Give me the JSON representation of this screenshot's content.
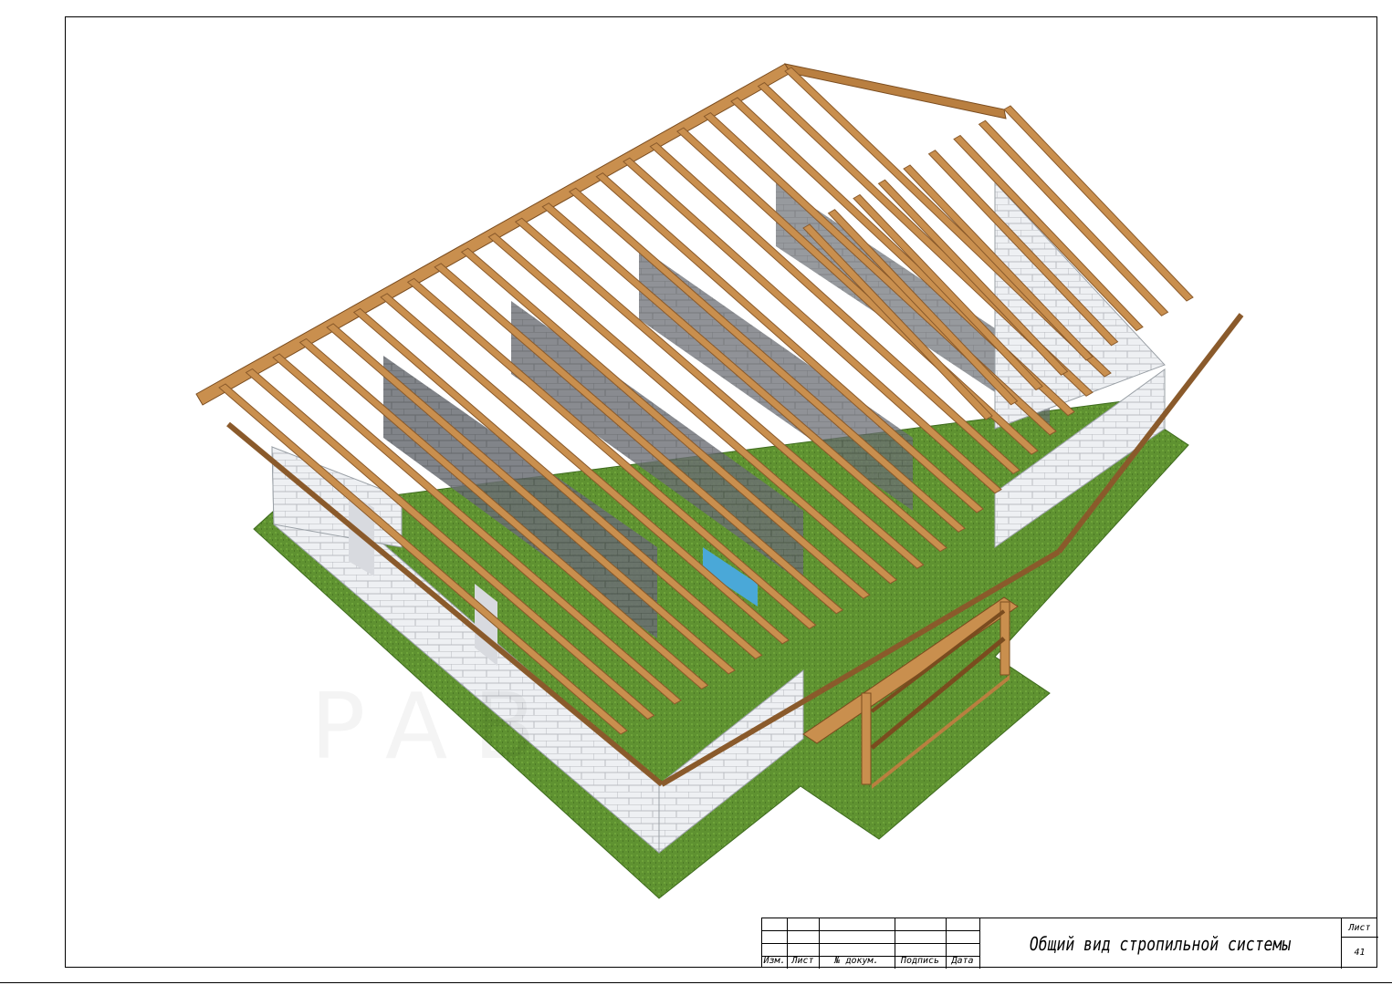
{
  "drawing": {
    "subject": "roof rafter system 3d view",
    "watermark": "PAB"
  },
  "title_block": {
    "col_izm": "Изм.",
    "col_list": "Лист",
    "col_doc": "№ докум.",
    "col_sign": "Подпись",
    "col_date": "Дата",
    "sheet_title": "Общий вид стропильной системы",
    "sheet_label": "Лист",
    "sheet_number": "41"
  },
  "colors": {
    "grass": "#5c8f2f",
    "wall": "#ecedf0",
    "wood": "#c98f4e",
    "wood_dark": "#8a5a2b",
    "frame": "#000000"
  }
}
